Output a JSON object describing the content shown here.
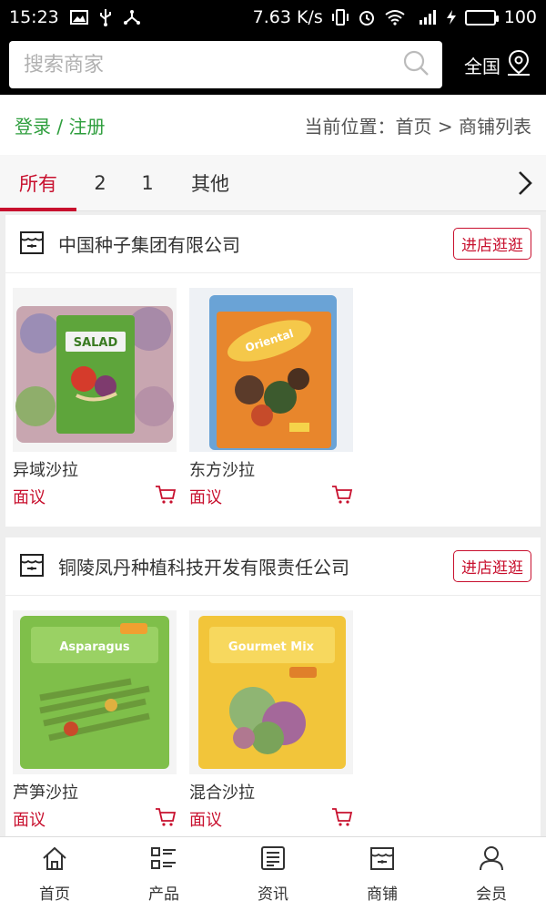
{
  "status_bar": {
    "time": "15:23",
    "speed": "7.63 K/s",
    "battery": "100"
  },
  "search": {
    "placeholder": "搜索商家",
    "region_label": "全国"
  },
  "breadcrumb": {
    "login_label": "登录 / 注册",
    "location": "当前位置：首页 > 商铺列表"
  },
  "tabs": [
    {
      "label": "所有",
      "active": true
    },
    {
      "label": "2"
    },
    {
      "label": "1"
    },
    {
      "label": "其他"
    }
  ],
  "shops": [
    {
      "name": "中国种子集团有限公司",
      "enter_label": "进店逛逛",
      "products": [
        {
          "name": "异域沙拉",
          "price": "面议"
        },
        {
          "name": "东方沙拉",
          "price": "面议"
        }
      ]
    },
    {
      "name": "铜陵凤丹种植科技开发有限责任公司",
      "enter_label": "进店逛逛",
      "products": [
        {
          "name": "芦笋沙拉",
          "price": "面议"
        },
        {
          "name": "混合沙拉",
          "price": "面议"
        }
      ]
    }
  ],
  "bottom_nav": [
    {
      "label": "首页",
      "icon": "home-icon"
    },
    {
      "label": "产品",
      "icon": "list-icon"
    },
    {
      "label": "资讯",
      "icon": "news-icon"
    },
    {
      "label": "商铺",
      "icon": "shop-icon"
    },
    {
      "label": "会员",
      "icon": "user-icon"
    }
  ],
  "colors": {
    "accent": "#c8102e",
    "login_green": "#2e9e3d"
  }
}
